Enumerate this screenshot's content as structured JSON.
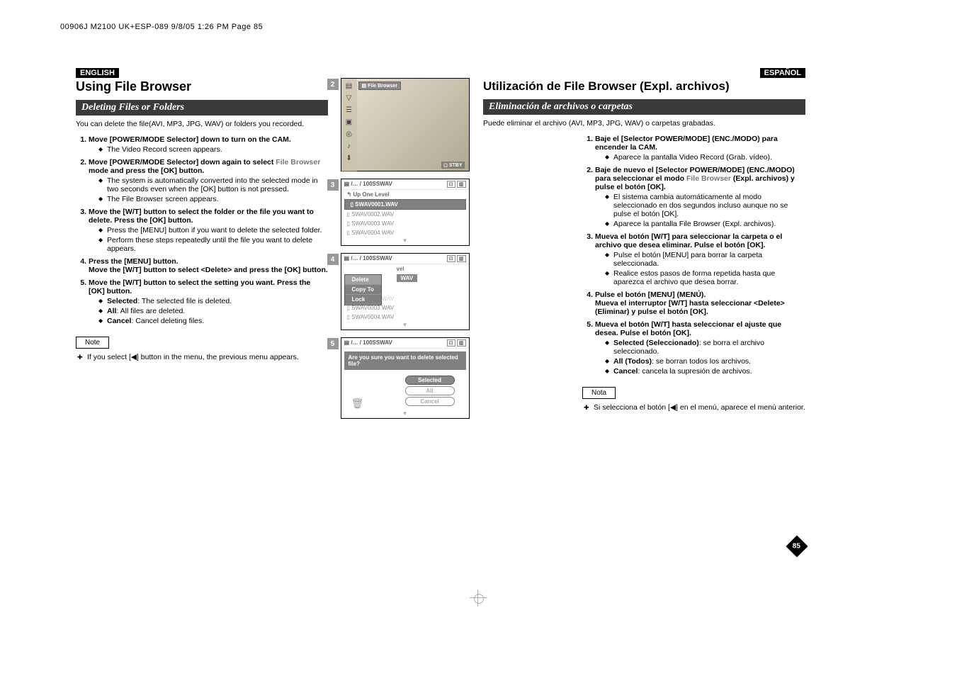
{
  "header_imprint": "00906J M2100 UK+ESP-089  9/8/05 1:26 PM  Page 85",
  "left": {
    "lang": "ENGLISH",
    "title": "Using File Browser",
    "section": "Deleting Files or Folders",
    "intro": "You can delete the file(AVI, MP3, JPG, WAV) or folders you recorded.",
    "steps": [
      {
        "text": "Move [POWER/MODE Selector] down to turn on the CAM.",
        "bullets": [
          "The Video Record screen appears."
        ]
      },
      {
        "text_parts": [
          "Move [POWER/MODE Selector] down again to select ",
          "File Browser",
          " mode and press the [OK] button."
        ],
        "bullets": [
          "The system is automatically converted into the selected mode in two seconds even when the [OK] button is not pressed.",
          "The File Browser screen appears."
        ]
      },
      {
        "text": "Move the [W/T] button to select the folder or the file you want to delete. Press the [OK] button.",
        "bullets": [
          "Press the [MENU] button if you want to delete the selected folder.",
          "Perform these steps repeatedly until the file you want to delete appears."
        ]
      },
      {
        "text": "Press the [MENU] button.",
        "text2": "Move the [W/T] button to select <Delete> and press the [OK] button."
      },
      {
        "text": "Move the [W/T] button to select the setting you want. Press the [OK] button.",
        "bullets_kv": [
          {
            "k": "Selected",
            "v": ": The selected file is deleted."
          },
          {
            "k": "All",
            "v": ": All files are deleted."
          },
          {
            "k": "Cancel",
            "v": ": Cancel deleting files."
          }
        ]
      }
    ],
    "note_label": "Note",
    "note_item": "If you select [◀] button in the menu, the previous menu appears."
  },
  "right": {
    "lang": "ESPAÑOL",
    "title": "Utilización de File Browser (Expl. archivos)",
    "section": "Eliminación de archivos o carpetas",
    "intro": "Puede eliminar el archivo (AVI, MP3, JPG, WAV) o carpetas grabadas.",
    "steps": [
      {
        "text": "Baje el [Selector POWER/MODE] (ENC./MODO) para encender la CAM.",
        "bullets": [
          "Aparece la pantalla Video Record (Grab. vídeo)."
        ]
      },
      {
        "text_parts": [
          "Baje de nuevo el [Selector POWER/MODE] (ENC./MODO) para seleccionar el modo ",
          "File Browser",
          " (Expl. archivos) y pulse el botón [OK]."
        ],
        "bullets": [
          "El sistema cambia automáticamente al modo seleccionado en dos segundos incluso aunque no se pulse el botón [OK].",
          "Aparece la pantalla File Browser (Expl. archivos)."
        ]
      },
      {
        "text": "Mueva el botón [W/T] para seleccionar la carpeta o el archivo que desea eliminar. Pulse el botón [OK].",
        "bullets": [
          "Pulse el botón [MENU] para borrar la carpeta seleccionada.",
          "Realice estos pasos de forma repetida hasta que aparezca el archivo que desea borrar."
        ]
      },
      {
        "text": "Pulse el botón [MENU] (MENÚ).",
        "text2": "Mueva el interruptor [W/T] hasta seleccionar <Delete> (Eliminar) y pulse el botón [OK]."
      },
      {
        "text": "Mueva el botón [W/T] hasta seleccionar el ajuste que desea. Pulse el botón [OK].",
        "bullets_kv": [
          {
            "k": "Selected (Seleccionado)",
            "v": ": se borra el archivo seleccionado."
          },
          {
            "k": "All (Todos)",
            "v": ": se borran todos los archivos."
          },
          {
            "k": "Cancel",
            "v": ": cancela la supresión de archivos."
          }
        ]
      }
    ],
    "note_label": "Nota",
    "note_item": "Si selecciona el botón [◀] en el menú, aparece el menú anterior."
  },
  "screens": {
    "s2": {
      "num": "2",
      "fb": "File Browser",
      "stby": "STBY"
    },
    "s3": {
      "num": "3",
      "path": "/… / 100SSWAV",
      "up": "Up One Level",
      "rows": [
        "SWAV0001.WAV",
        "SWAV0002.WAV",
        "SWAV0003.WAV",
        "SWAV0004.WAV"
      ]
    },
    "s4": {
      "num": "4",
      "path": "/… / 100SSWAV",
      "vel": "vel",
      "wav": "WAV",
      "menu": [
        "Delete",
        "Copy To",
        "Lock"
      ],
      "rows_faded": [
        "SWAV0002.WAV",
        "SWAV0003.WAV",
        "SWAV0004.WAV"
      ]
    },
    "s5": {
      "num": "5",
      "path": "/… / 100SSWAV",
      "confirm": "Are you sure you want to delete selected file?",
      "btn_sel": "Selected",
      "btn_all": "All",
      "btn_cancel": "Cancel"
    }
  },
  "page_num": "85"
}
